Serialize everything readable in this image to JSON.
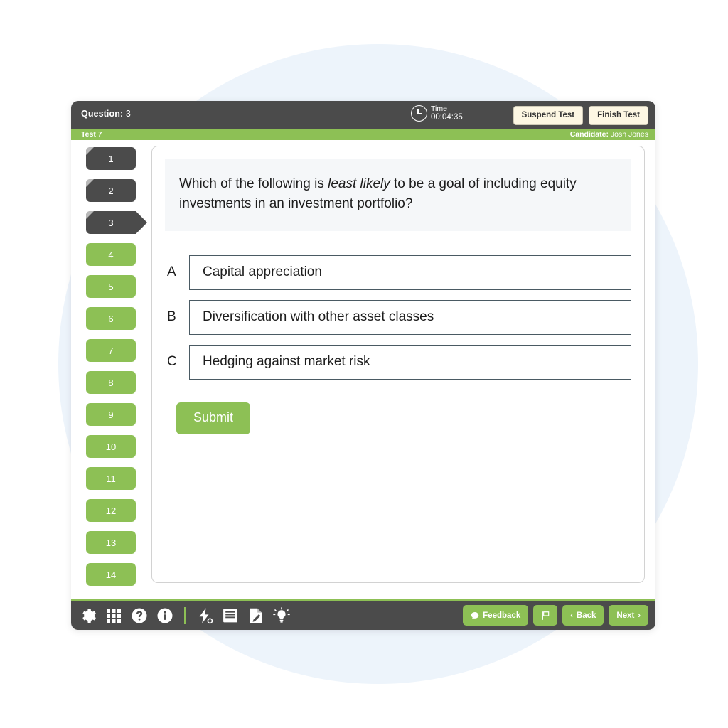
{
  "header": {
    "question_label": "Question:",
    "question_number": "3",
    "timer_title": "Time",
    "timer_value": "00:04:35",
    "clock_icon": "clock-icon",
    "suspend_label": "Suspend Test",
    "finish_label": "Finish Test"
  },
  "subheader": {
    "test_name": "Test 7",
    "candidate_label": "Candidate:",
    "candidate_name": "Josh Jones"
  },
  "nav": {
    "items": [
      {
        "number": "1",
        "state": "answered"
      },
      {
        "number": "2",
        "state": "answered"
      },
      {
        "number": "3",
        "state": "current"
      },
      {
        "number": "4",
        "state": "unanswered"
      },
      {
        "number": "5",
        "state": "unanswered"
      },
      {
        "number": "6",
        "state": "unanswered"
      },
      {
        "number": "7",
        "state": "unanswered"
      },
      {
        "number": "8",
        "state": "unanswered"
      },
      {
        "number": "9",
        "state": "unanswered"
      },
      {
        "number": "10",
        "state": "unanswered"
      },
      {
        "number": "11",
        "state": "unanswered"
      },
      {
        "number": "12",
        "state": "unanswered"
      },
      {
        "number": "13",
        "state": "unanswered"
      },
      {
        "number": "14",
        "state": "unanswered"
      }
    ]
  },
  "question": {
    "stem_part1": "Which of the following is ",
    "stem_emphasis": "least likely",
    "stem_part2": " to be a goal of including equity investments in an investment portfolio?",
    "options": [
      {
        "letter": "A",
        "text": "Capital appreciation"
      },
      {
        "letter": "B",
        "text": "Diversification with other asset classes"
      },
      {
        "letter": "C",
        "text": "Hedging against market risk"
      }
    ],
    "submit_label": "Submit"
  },
  "toolbar": {
    "icons": [
      {
        "name": "gear-icon"
      },
      {
        "name": "grid-icon"
      },
      {
        "name": "help-icon"
      },
      {
        "name": "info-icon"
      },
      {
        "name": "separator"
      },
      {
        "name": "lightning-icon"
      },
      {
        "name": "notes-icon"
      },
      {
        "name": "scratchpad-icon"
      },
      {
        "name": "lightbulb-icon"
      }
    ],
    "lightning_count": "0",
    "feedback_label": "Feedback",
    "flag_icon": "flag-icon",
    "back_label": "Back",
    "back_chevron": "‹",
    "next_label": "Next",
    "next_chevron": "›"
  },
  "colors": {
    "brand_green": "#8dc055",
    "dark_gray": "#4b4b4b",
    "cream_button": "#fdf7e3",
    "stem_background": "#f5f7f9",
    "option_border": "#4a5a63",
    "circle_background": "#edf4fb"
  }
}
